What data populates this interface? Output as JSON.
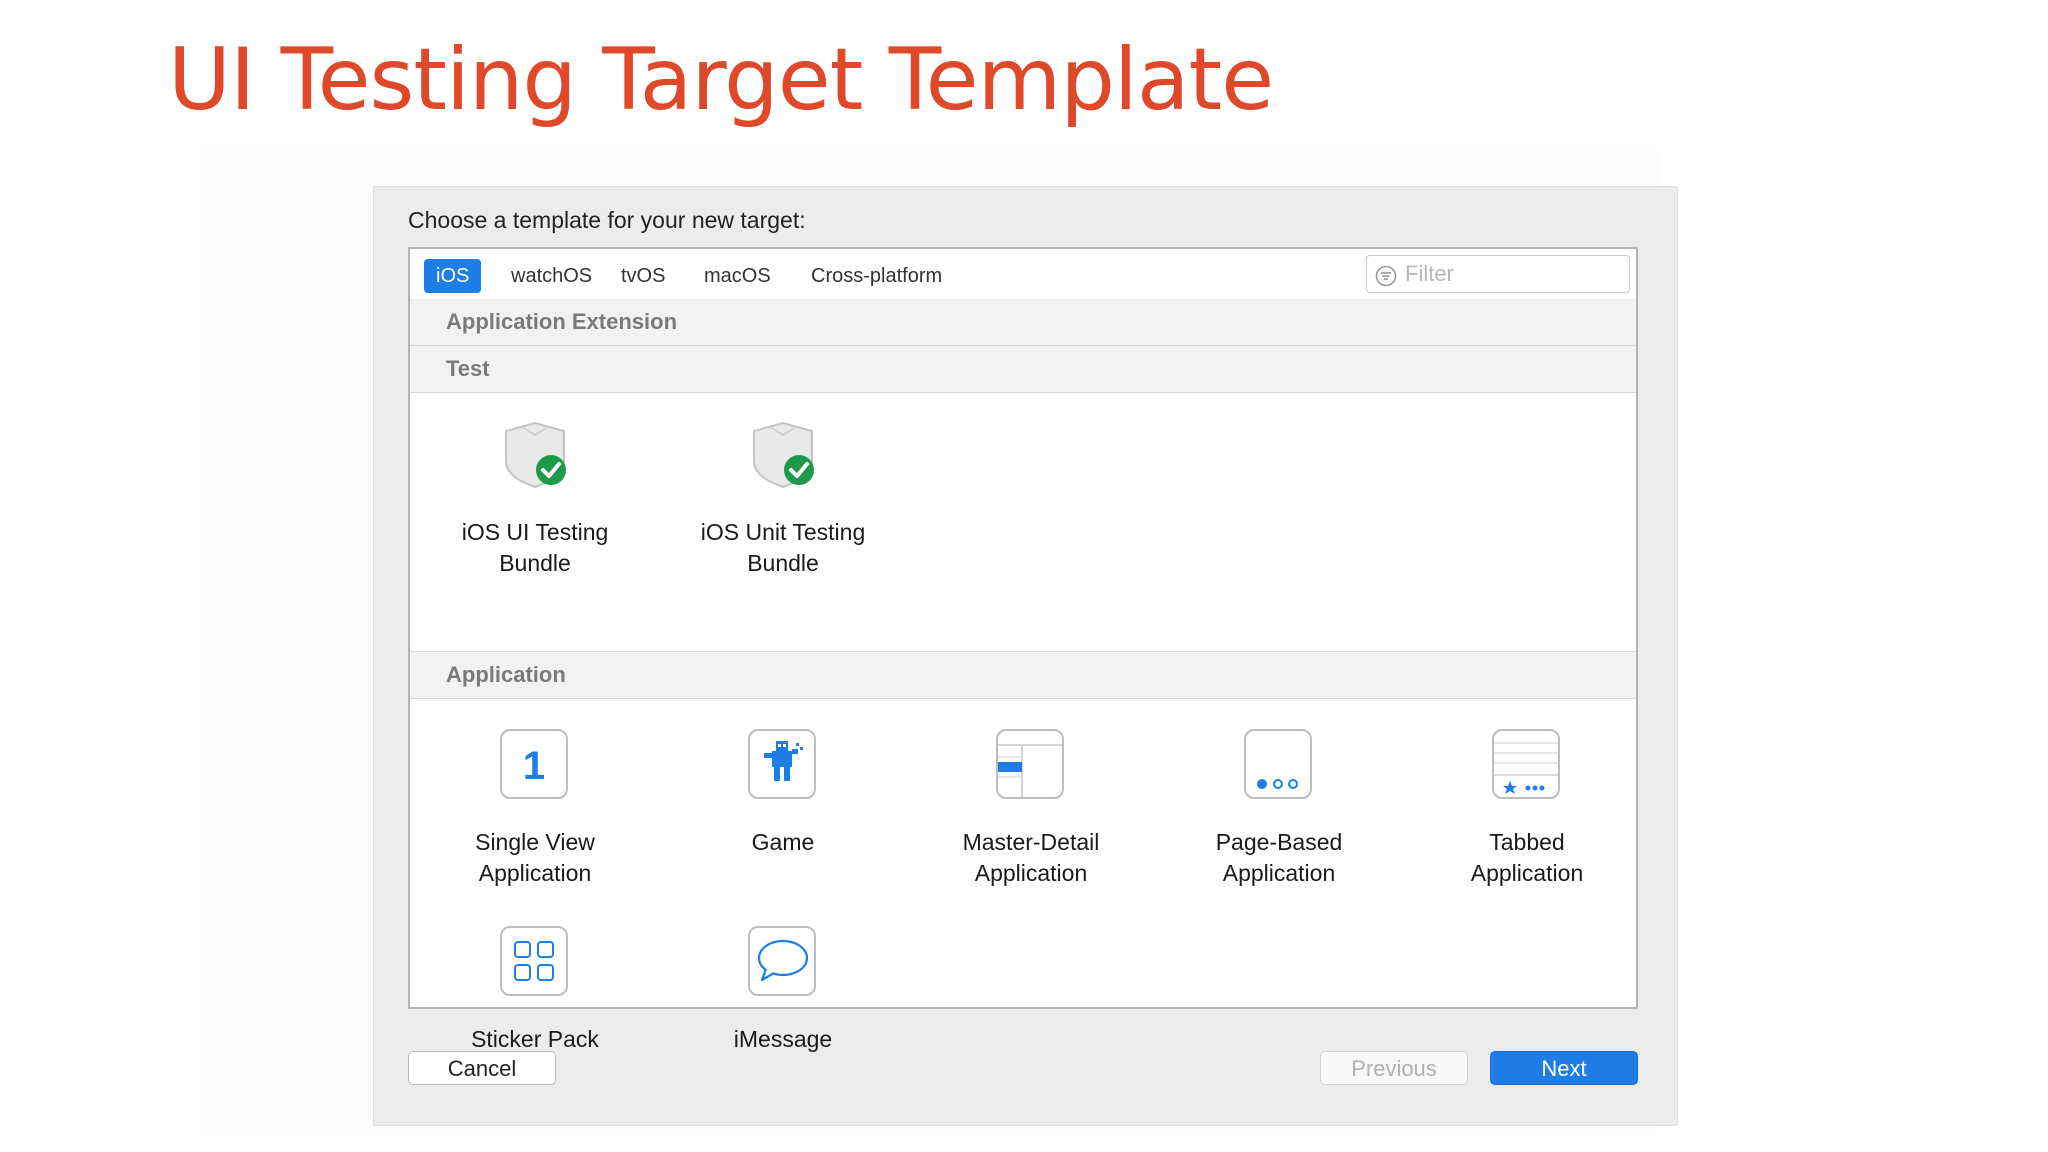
{
  "slide": {
    "title": "UI Testing Target Template"
  },
  "dialog": {
    "prompt": "Choose a template for your new target:",
    "tabs": [
      {
        "label": "iOS",
        "selected": true
      },
      {
        "label": "watchOS",
        "selected": false
      },
      {
        "label": "tvOS",
        "selected": false
      },
      {
        "label": "macOS",
        "selected": false
      },
      {
        "label": "Cross-platform",
        "selected": false
      }
    ],
    "filter": {
      "placeholder": "Filter",
      "value": ""
    },
    "sections": [
      {
        "title": "Application Extension",
        "items": []
      },
      {
        "title": "Test",
        "items": [
          {
            "label_line1": "iOS UI Testing",
            "label_line2": "Bundle",
            "icon": "test-bundle-icon"
          },
          {
            "label_line1": "iOS Unit Testing",
            "label_line2": "Bundle",
            "icon": "test-bundle-icon"
          }
        ]
      },
      {
        "title": "Application",
        "items": [
          {
            "label_line1": "Single View",
            "label_line2": "Application",
            "icon": "single-view-icon"
          },
          {
            "label_line1": "Game",
            "label_line2": "",
            "icon": "game-icon"
          },
          {
            "label_line1": "Master-Detail",
            "label_line2": "Application",
            "icon": "master-detail-icon"
          },
          {
            "label_line1": "Page-Based",
            "label_line2": "Application",
            "icon": "page-based-icon"
          },
          {
            "label_line1": "Tabbed",
            "label_line2": "Application",
            "icon": "tabbed-icon"
          },
          {
            "label_line1": "Sticker Pack",
            "label_line2": "",
            "icon": "sticker-pack-icon"
          },
          {
            "label_line1": "iMessage",
            "label_line2": "",
            "icon": "imessage-icon"
          }
        ]
      }
    ],
    "buttons": {
      "cancel": "Cancel",
      "previous": "Previous",
      "next": "Next"
    }
  },
  "colors": {
    "title": "#e0482a",
    "accent": "#1e7ee6",
    "check": "#1f9a4a"
  }
}
